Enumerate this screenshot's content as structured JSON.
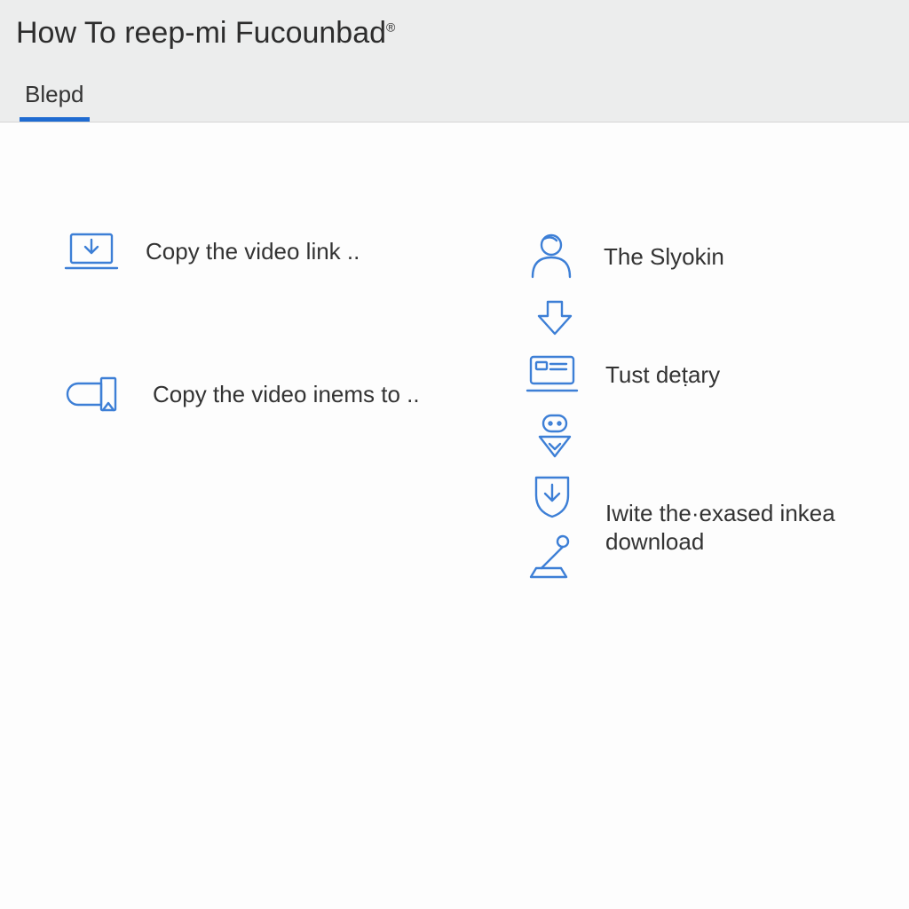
{
  "header": {
    "title_pre": "How To reep-mi Fucounbad",
    "title_mark": "®"
  },
  "tabs": {
    "items": [
      {
        "label": "Blepd"
      }
    ]
  },
  "left_steps": [
    {
      "text": "Copy the video link .."
    },
    {
      "text": "Copy the video inems to .."
    }
  ],
  "right_steps": [
    {
      "text": "The Slyokin"
    },
    {
      "text": "Tust deṭary"
    },
    {
      "text": "Iwite the·exased inkea download"
    }
  ]
}
